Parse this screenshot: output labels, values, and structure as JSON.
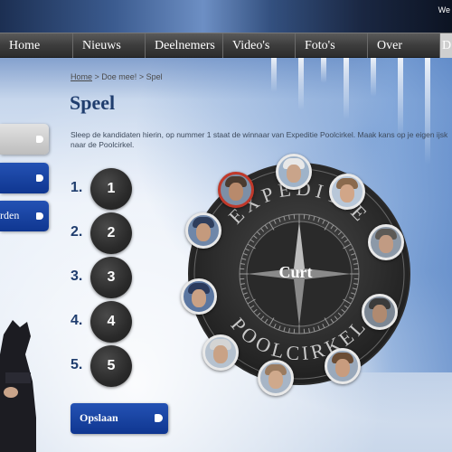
{
  "topbar": {
    "text": "We"
  },
  "nav": {
    "items": [
      {
        "label": "Home"
      },
      {
        "label": "Nieuws"
      },
      {
        "label": "Deelnemers"
      },
      {
        "label": "Video's"
      },
      {
        "label": "Foto's"
      },
      {
        "label": "Over"
      },
      {
        "label": "D"
      }
    ]
  },
  "sidebar": {
    "items": [
      {
        "label": ""
      },
      {
        "label": ""
      },
      {
        "label": "rden"
      }
    ]
  },
  "breadcrumb": {
    "home": "Home",
    "sep1": " > ",
    "doe_mee": "Doe mee!",
    "sep2": " > ",
    "current": "Spel"
  },
  "page": {
    "title": "Speel",
    "intro": "Sleep de kandidaten hierin, op nummer 1 staat de winnaar van Expeditie Poolcirkel. Maak kans op je eigen ijsk naar de Poolcirkel."
  },
  "ranking": [
    {
      "number": "1.",
      "slot": "1"
    },
    {
      "number": "2.",
      "slot": "2"
    },
    {
      "number": "3.",
      "slot": "3"
    },
    {
      "number": "4.",
      "slot": "4"
    },
    {
      "number": "5.",
      "slot": "5"
    }
  ],
  "save_button": {
    "label": "Opslaan"
  },
  "compass": {
    "text_top": "EXPEDITIE",
    "text_bottom": "POOLCIRKEL",
    "center_name": "Curt"
  },
  "colors": {
    "nav_bg": "#3d3d3d",
    "button_blue": "#1a43a0",
    "title_blue": "#1f3d6e",
    "selected_ring": "#c0392b"
  }
}
